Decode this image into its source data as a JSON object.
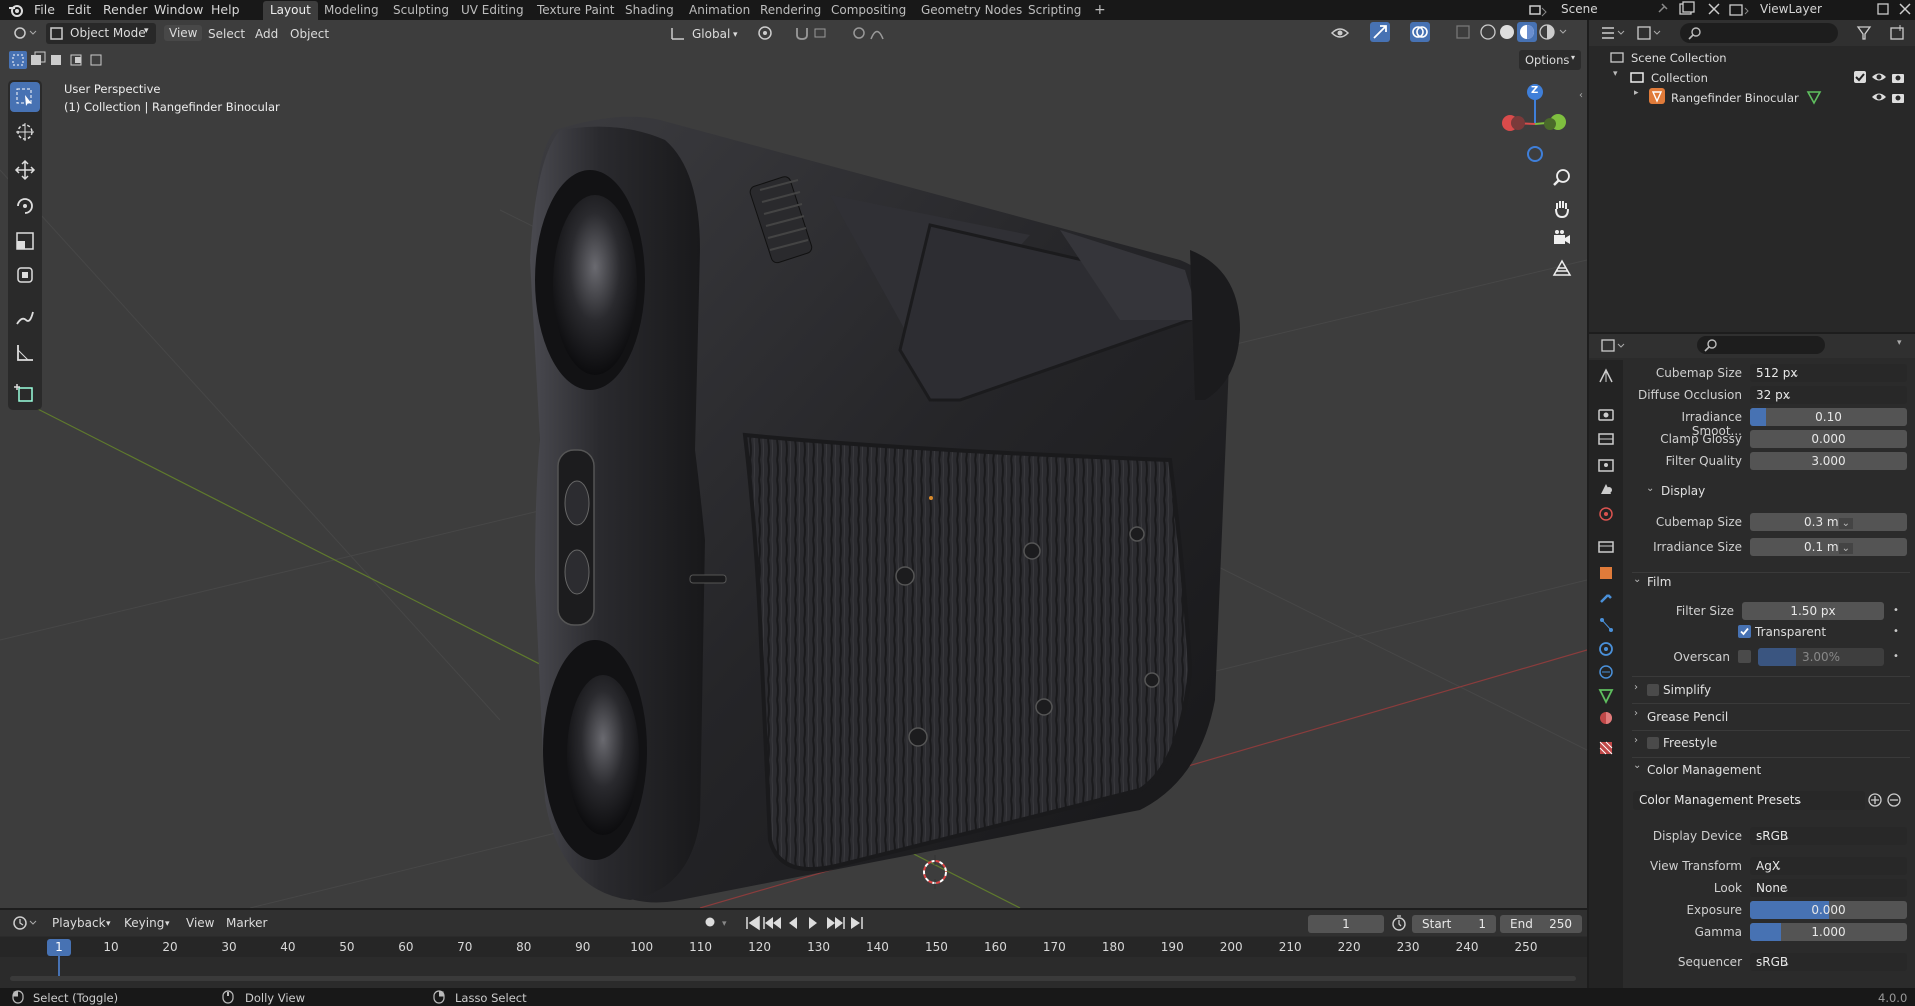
{
  "menubar": {
    "items": [
      "File",
      "Edit",
      "Render",
      "Window",
      "Help"
    ],
    "workspaces": [
      "Layout",
      "Modeling",
      "Sculpting",
      "UV Editing",
      "Texture Paint",
      "Shading",
      "Animation",
      "Rendering",
      "Compositing",
      "Geometry Nodes",
      "Scripting"
    ],
    "active_workspace": "Layout",
    "add_tab": "+",
    "scene": "Scene",
    "view_layer": "ViewLayer"
  },
  "viewport_header": {
    "mode": "Object Mode",
    "menus": [
      "View",
      "Select",
      "Add",
      "Object"
    ],
    "transform_orientation": "Global",
    "options": "Options"
  },
  "viewport": {
    "view_name": "User Perspective",
    "collection_info": "(1) Collection | Rangefinder Binocular",
    "gizmo_axis_z": "Z"
  },
  "outliner": {
    "scene_collection": "Scene Collection",
    "collection": "Collection",
    "object": "Rangefinder Binocular"
  },
  "properties": {
    "rows": [
      {
        "label": "Cubemap Size",
        "value": "512 px",
        "kind": "dropdown"
      },
      {
        "label": "Diffuse Occlusion",
        "value": "32 px",
        "kind": "dropdown"
      },
      {
        "label": "Irradiance Smoot...",
        "value": "0.10",
        "kind": "slider",
        "fill": 0.1
      },
      {
        "label": "Clamp Glossy",
        "value": "0.000",
        "kind": "number"
      },
      {
        "label": "Filter Quality",
        "value": "3.000",
        "kind": "number"
      }
    ],
    "display_section": "Display",
    "display_rows": [
      {
        "label": "Cubemap Size",
        "value": "0.3 m"
      },
      {
        "label": "Irradiance Size",
        "value": "0.1 m"
      }
    ],
    "film_section": "Film",
    "filter_size_label": "Filter Size",
    "filter_size": "1.50 px",
    "transparent_label": "Transparent",
    "transparent_checked": true,
    "overscan_label": "Overscan",
    "overscan_value": "3.00%",
    "simplify": "Simplify",
    "grease_pencil": "Grease Pencil",
    "freestyle": "Freestyle",
    "color_management": "Color Management",
    "cm_presets": "Color Management Presets",
    "cm_rows": [
      {
        "label": "Display Device",
        "value": "sRGB",
        "kind": "dropdown"
      },
      {
        "label": "View Transform",
        "value": "AgX",
        "kind": "dropdown"
      },
      {
        "label": "Look",
        "value": "None",
        "kind": "dropdown"
      },
      {
        "label": "Exposure",
        "value": "0.000",
        "kind": "slider",
        "fill": 0.5
      },
      {
        "label": "Gamma",
        "value": "1.000",
        "kind": "slider",
        "fill": 0.2
      }
    ],
    "sequencer_label": "Sequencer",
    "sequencer_value": "sRGB"
  },
  "timeline": {
    "menus": [
      "Playback",
      "Keying",
      "View",
      "Marker"
    ],
    "current_frame": "1",
    "start_label": "Start",
    "start": "1",
    "end_label": "End",
    "end": "250",
    "ticks": [
      "1",
      "10",
      "20",
      "30",
      "40",
      "50",
      "60",
      "70",
      "80",
      "90",
      "100",
      "110",
      "120",
      "130",
      "140",
      "150",
      "160",
      "170",
      "180",
      "190",
      "200",
      "210",
      "220",
      "230",
      "240",
      "250"
    ]
  },
  "statusbar": {
    "select": "Select (Toggle)",
    "dolly": "Dolly View",
    "lasso": "Lasso Select",
    "version": "4.0.0"
  },
  "colors": {
    "accent": "#4772b3",
    "axis_x": "#d94b4b",
    "axis_y": "#7fbf3f",
    "axis_z": "#3f7fd9"
  }
}
